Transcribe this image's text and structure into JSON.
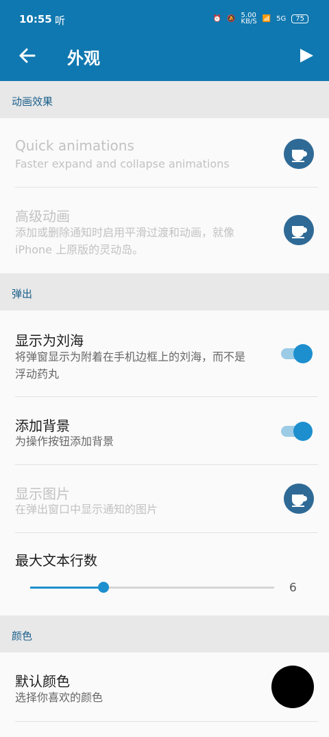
{
  "status_bar": {
    "time": "10:55",
    "carrier_icon_text": "听",
    "net_speed": "5.00\nKB/S",
    "signal": "5G",
    "battery": "75"
  },
  "app_bar": {
    "title": "外观"
  },
  "sections": {
    "animation": "动画效果",
    "popup": "弹出",
    "color": "颜色"
  },
  "rows": {
    "quick_animations": {
      "label": "Quick animations",
      "sub": "Faster expand and collapse animations"
    },
    "advanced_animations": {
      "label": "高级动画",
      "sub": "添加或删除通知时启用平滑过渡和动画，就像 iPhone 上原版的灵动岛。"
    },
    "show_as_notch": {
      "label": "显示为刘海",
      "sub": "将弹窗显示为附着在手机边框上的刘海，而不是浮动药丸",
      "enabled": true
    },
    "add_background": {
      "label": "添加背景",
      "sub": "为操作按钮添加背景",
      "enabled": true
    },
    "show_image": {
      "label": "显示图片",
      "sub": "在弹出窗口中显示通知的图片"
    },
    "max_text_lines": {
      "label": "最大文本行数",
      "value": "6",
      "fraction": 0.3
    },
    "default_color": {
      "label": "默认颜色",
      "sub": "选择你喜欢的颜色",
      "color": "#000000"
    }
  },
  "colors": {
    "accent": "#1078b0",
    "switch_on": "#1d8fce",
    "premium_icon_bg": "#2f6a96"
  },
  "icons": [
    "back-arrow-icon",
    "play-icon",
    "coffee-cup-icon",
    "alarm-icon",
    "mute-icon",
    "wifi-icon",
    "signal-icon",
    "battery-icon"
  ]
}
